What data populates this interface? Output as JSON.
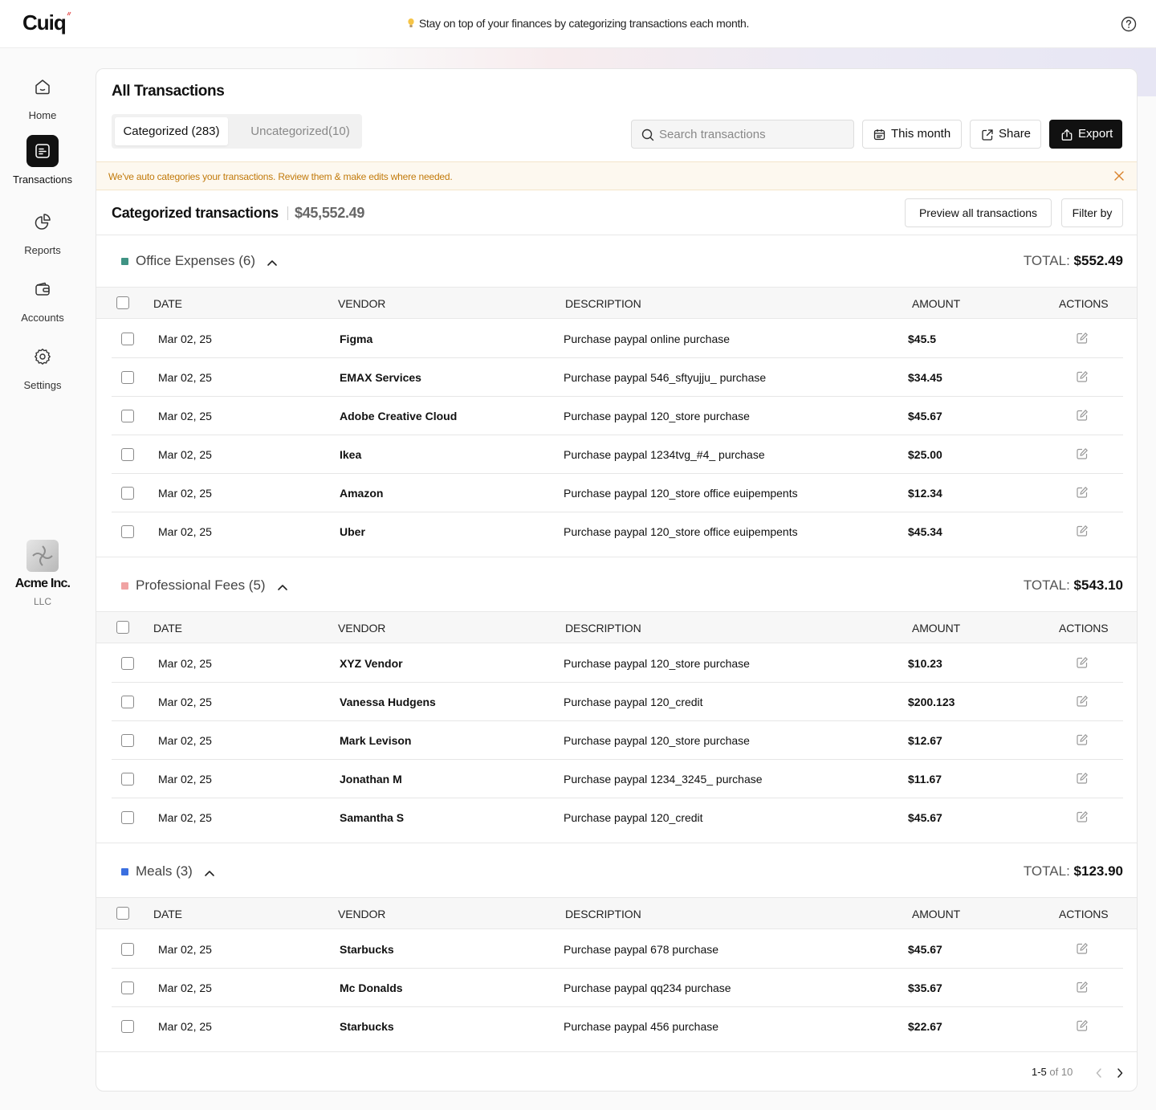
{
  "app": {
    "logo": "Cuiq",
    "tip": "Stay on top of your finances by categorizing transactions each month."
  },
  "sidebar": {
    "items": [
      {
        "label": "Home",
        "icon": "home-icon"
      },
      {
        "label": "Transactions",
        "icon": "transactions-icon",
        "active": true
      },
      {
        "label": "Reports",
        "icon": "reports-icon"
      },
      {
        "label": "Accounts",
        "icon": "wallet-icon"
      },
      {
        "label": "Settings",
        "icon": "gear-icon"
      }
    ],
    "company": {
      "name": "Acme Inc.",
      "type": "LLC"
    }
  },
  "page": {
    "title": "All Transactions",
    "tabs": [
      {
        "label": "Categorized (283)"
      },
      {
        "label": "Uncategorized(10)"
      }
    ],
    "search_placeholder": "Search transactions",
    "this_month": "This month",
    "share": "Share",
    "export": "Export",
    "notice": "We've auto categories your transactions. Review them & make edits where needed.",
    "summary_label": "Categorized transactions",
    "summary_amount": "$45,552.49",
    "preview_all": "Preview all transactions",
    "filter_by": "Filter by"
  },
  "columns": {
    "date": "DATE",
    "vendor": "VENDOR",
    "description": "DESCRIPTION",
    "amount": "AMOUNT",
    "actions": "ACTIONS"
  },
  "groups": [
    {
      "name": "Office Expenses (6)",
      "color": "#3f9384",
      "total_label": "TOTAL:",
      "total": "$552.49",
      "rows": [
        {
          "date": "Mar 02, 25",
          "vendor": "Figma",
          "description": "Purchase paypal online purchase",
          "amount": "$45.5"
        },
        {
          "date": "Mar 02, 25",
          "vendor": "EMAX Services",
          "description": "Purchase paypal 546_sftyujju_ purchase",
          "amount": "$34.45"
        },
        {
          "date": "Mar 02, 25",
          "vendor": "Adobe Creative Cloud",
          "description": "Purchase paypal 120_store purchase",
          "amount": "$45.67"
        },
        {
          "date": "Mar 02, 25",
          "vendor": "Ikea",
          "description": "Purchase paypal 1234tvg_#4_ purchase",
          "amount": "$25.00"
        },
        {
          "date": "Mar 02, 25",
          "vendor": "Amazon",
          "description": "Purchase paypal 120_store office euipempents",
          "amount": "$12.34"
        },
        {
          "date": "Mar 02, 25",
          "vendor": "Uber",
          "description": "Purchase paypal 120_store office euipempents",
          "amount": "$45.34"
        }
      ]
    },
    {
      "name": "Professional Fees (5)",
      "color": "#f0a3a3",
      "total_label": "TOTAL:",
      "total": "$543.10",
      "rows": [
        {
          "date": "Mar 02, 25",
          "vendor": "XYZ Vendor",
          "description": "Purchase paypal 120_store purchase",
          "amount": "$10.23"
        },
        {
          "date": "Mar 02, 25",
          "vendor": "Vanessa Hudgens",
          "description": "Purchase paypal 120_credit",
          "amount": "$200.123"
        },
        {
          "date": "Mar 02, 25",
          "vendor": "Mark Levison",
          "description": "Purchase paypal 120_store purchase",
          "amount": "$12.67"
        },
        {
          "date": "Mar 02, 25",
          "vendor": "Jonathan M",
          "description": "Purchase paypal 1234_3245_ purchase",
          "amount": "$11.67"
        },
        {
          "date": "Mar 02, 25",
          "vendor": "Samantha S",
          "description": "Purchase paypal 120_credit",
          "amount": "$45.67"
        }
      ]
    },
    {
      "name": "Meals (3)",
      "color": "#3b6fe0",
      "total_label": "TOTAL:",
      "total": "$123.90",
      "rows": [
        {
          "date": "Mar 02, 25",
          "vendor": "Starbucks",
          "description": "Purchase paypal 678 purchase",
          "amount": "$45.67"
        },
        {
          "date": "Mar 02, 25",
          "vendor": "Mc Donalds",
          "description": "Purchase paypal qq234 purchase",
          "amount": "$35.67"
        },
        {
          "date": "Mar 02, 25",
          "vendor": "Starbucks",
          "description": "Purchase paypal 456 purchase",
          "amount": "$22.67"
        }
      ]
    }
  ],
  "pagination": {
    "range": "1-5",
    "of": "of 10"
  }
}
